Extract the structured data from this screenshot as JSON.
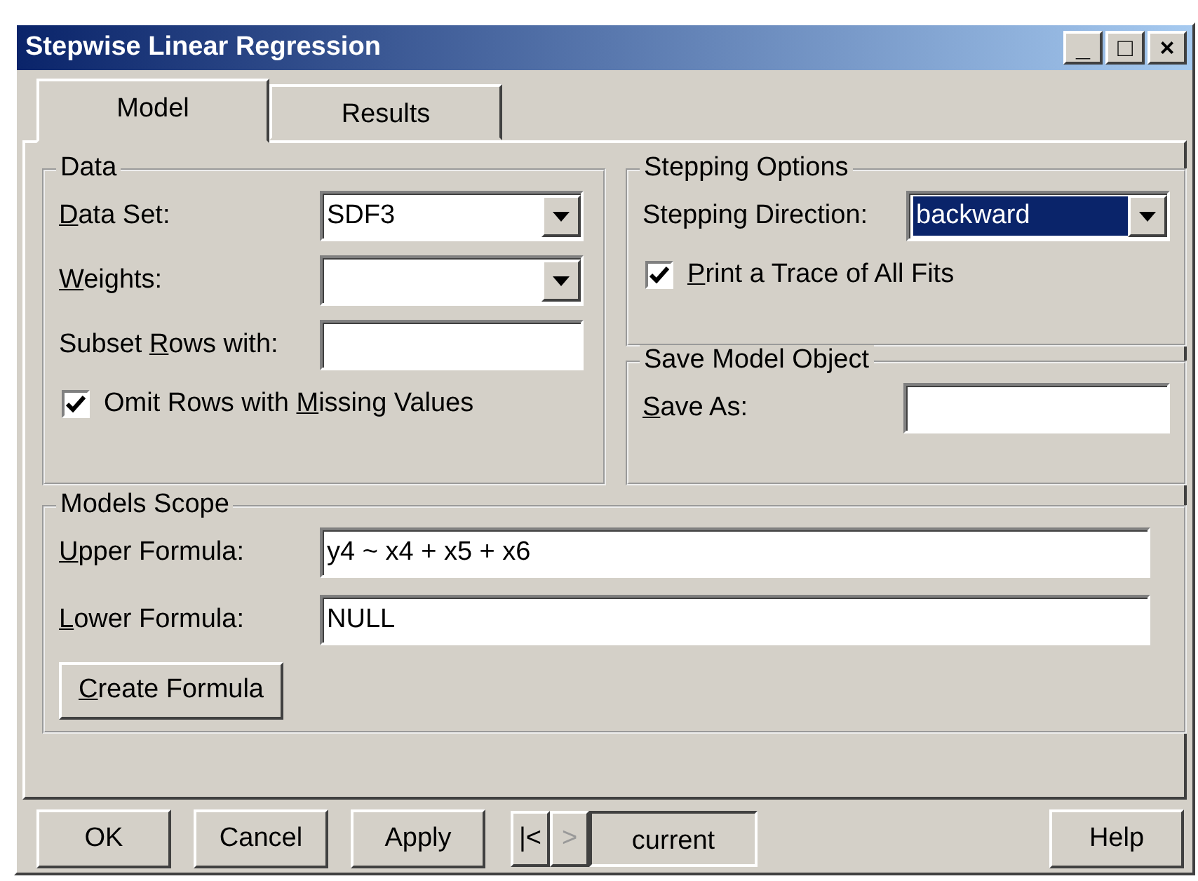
{
  "window": {
    "title": "Stepwise Linear Regression",
    "controls": [
      "_",
      "□",
      "×"
    ]
  },
  "tabs": [
    {
      "label": "Model",
      "selected": true
    },
    {
      "label": "Results",
      "selected": false
    }
  ],
  "data_group": {
    "title": "Data",
    "fields": [
      {
        "kind": "combo",
        "mnemonic": "D",
        "label_after": "ata Set:",
        "value": "SDF3"
      },
      {
        "kind": "combo",
        "mnemonic": "W",
        "label_after": "eights:"
      },
      {
        "kind": "text",
        "label_before": "Subset ",
        "mnemonic": "R",
        "label_after": "ows with:"
      },
      {
        "kind": "check",
        "label_before": "Omit Rows with ",
        "mnemonic": "M",
        "label_after": "issing Values",
        "checked": true
      }
    ]
  },
  "stepping_group": {
    "title": "Stepping Options",
    "fields": [
      {
        "kind": "combo",
        "label_before": "Stepping Direction:",
        "value": "backward",
        "selected": true
      },
      {
        "kind": "check",
        "mnemonic": "P",
        "label_after": "rint a Trace of All Fits",
        "checked": true
      }
    ]
  },
  "save_group": {
    "title": "Save Model Object",
    "fields": [
      {
        "kind": "text",
        "mnemonic": "S",
        "label_after": "ave As:"
      }
    ]
  },
  "scope_group": {
    "title": "Models Scope",
    "fields": [
      {
        "kind": "text",
        "mnemonic": "U",
        "label_after": "pper Formula:",
        "value": "y4 ~ x4 + x5 + x6"
      },
      {
        "kind": "text",
        "mnemonic": "L",
        "label_after": "ower Formula:",
        "value": "NULL"
      }
    ],
    "button": {
      "mnemonic": "C",
      "label_after": "reate Formula"
    }
  },
  "buttons": [
    {
      "label": "OK"
    },
    {
      "label": "Cancel"
    },
    {
      "label": "Apply"
    }
  ],
  "pager": {
    "first": "|<",
    "next": ">",
    "next_disabled": true,
    "current": "current"
  },
  "help_button": {
    "label": "Help"
  }
}
